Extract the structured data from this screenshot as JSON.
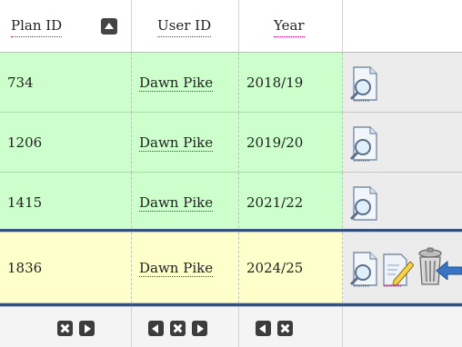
{
  "columns": {
    "plan_id": "Plan ID",
    "user_id": "User ID",
    "year": "Year"
  },
  "rows": [
    {
      "plan_id": "734",
      "user_id": "Dawn Pike",
      "year": "2018/19"
    },
    {
      "plan_id": "1206",
      "user_id": "Dawn Pike",
      "year": "2019/20"
    },
    {
      "plan_id": "1415",
      "user_id": "Dawn Pike",
      "year": "2021/22"
    },
    {
      "plan_id": "1836",
      "user_id": "Dawn Pike",
      "year": "2024/25"
    }
  ],
  "colors": {
    "row_green": "#ccffcc",
    "row_selected": "#ffffcc",
    "selection_line": "#35507a",
    "link_underline": "#c4006b"
  },
  "icons": {
    "view": "magnifier-document-icon",
    "edit": "pencil-document-icon",
    "delete": "trash-can-icon",
    "pointer": "arrow-left-icon"
  }
}
